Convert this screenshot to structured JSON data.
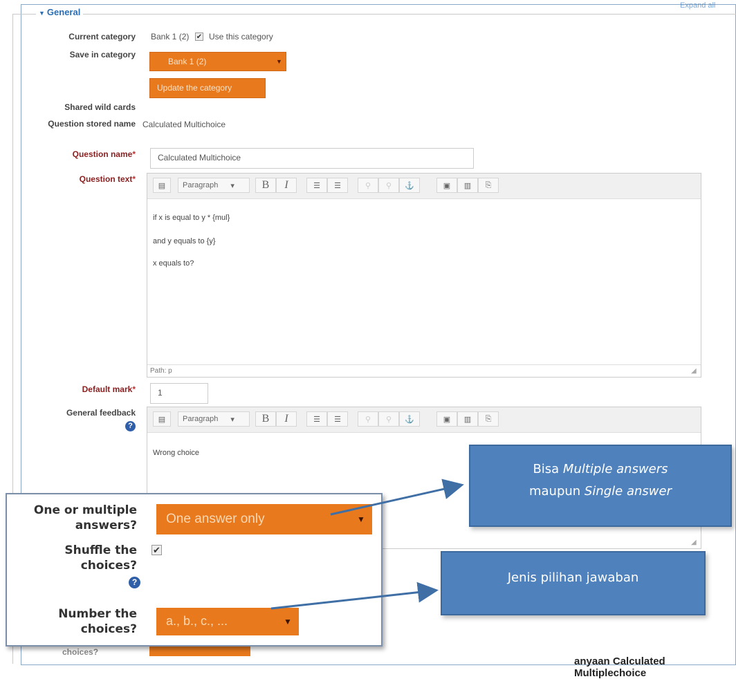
{
  "section": {
    "title": "General",
    "top_right_link": "Expand all"
  },
  "current_category": {
    "label": "Current category",
    "value": "Bank 1 (2)",
    "checkbox_label": "Use this category",
    "checked": true
  },
  "save_in_category": {
    "label": "Save in category",
    "selected": "Bank 1 (2)",
    "update_button": "Update the category"
  },
  "shared_wild_cards": {
    "label": "Shared wild cards"
  },
  "question_stored_name": {
    "label": "Question stored name",
    "value": "Calculated Multichoice"
  },
  "question_name": {
    "label": "Question name",
    "value": "Calculated Multichoice"
  },
  "question_text": {
    "label": "Question text",
    "toolbar": {
      "paragraph": "Paragraph"
    },
    "lines": [
      "if x is equal to y * {mul}",
      "and y equals to {y}",
      "x equals to?"
    ],
    "path": "Path: p"
  },
  "default_mark": {
    "label": "Default mark",
    "value": "1"
  },
  "general_feedback": {
    "label": "General feedback",
    "toolbar": {
      "paragraph": "Paragraph"
    },
    "text": "Wrong choice"
  },
  "zoom": {
    "one_or_multiple": {
      "label": "One or multiple answers?",
      "selected": "One answer only"
    },
    "shuffle": {
      "label": "Shuffle the choices?",
      "checked": true
    },
    "number_choices": {
      "label": "Number the choices?",
      "selected": "a., b., c., ..."
    }
  },
  "callouts": {
    "first": {
      "text_a": "Bisa ",
      "text_b": "Multiple answers",
      "text_c": "maupun ",
      "text_d": "Single answer"
    },
    "second": {
      "text": "Jenis pilihan jawaban"
    }
  },
  "caption": "anyaan Calculated Multiplechoice",
  "colors": {
    "accent_orange": "#e8791d",
    "callout_blue": "#4f81bd",
    "required_red": "#8b1f1f",
    "link_blue": "#2a6eb5"
  }
}
